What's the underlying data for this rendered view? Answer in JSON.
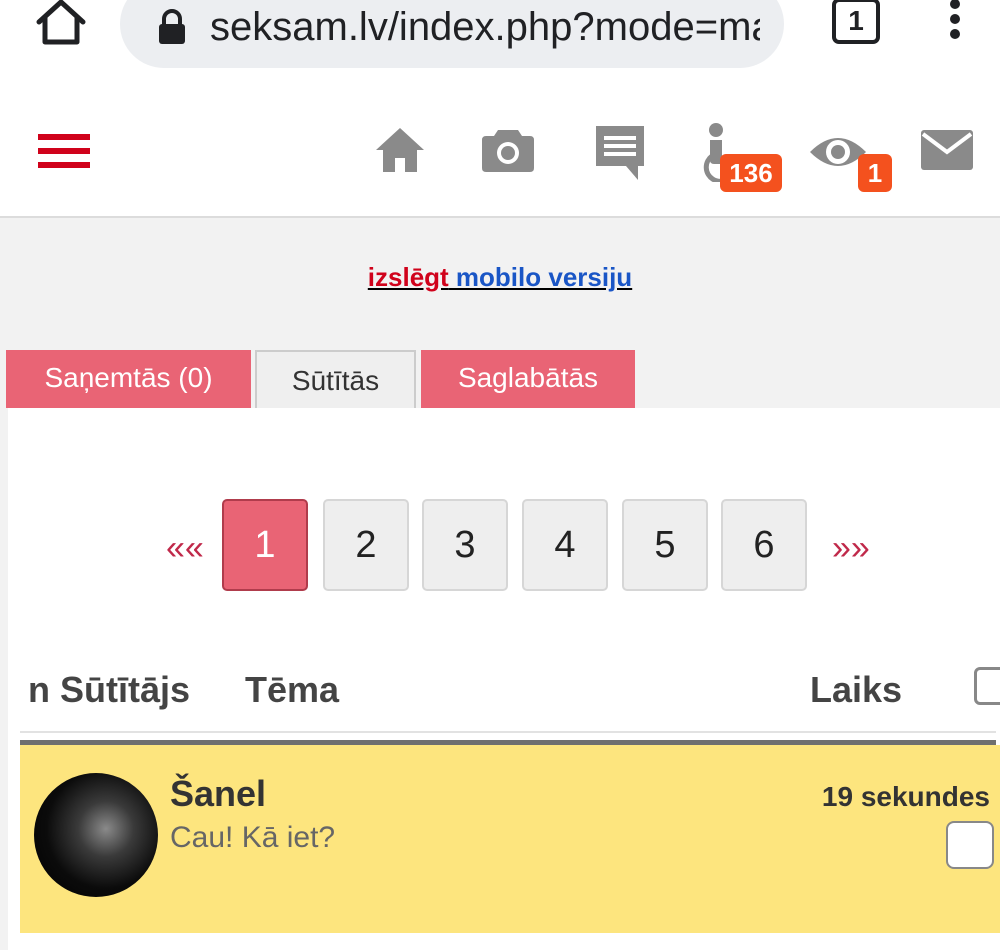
{
  "browser": {
    "url": "seksam.lv/index.php?mode=ma",
    "tab_count": "1"
  },
  "header": {
    "icons": [
      "menu-icon",
      "home-icon",
      "camera-icon",
      "chat-icon",
      "visitors-icon",
      "eye-icon",
      "mail-icon"
    ],
    "accent_color": "#d0021b",
    "badges": {
      "visitors": "136",
      "views": "1"
    }
  },
  "mobile_switch": {
    "red_part": "izslēgt",
    "blue_part": " mobilo versiju"
  },
  "folders": {
    "tabs": [
      {
        "label": "Saņemtās (0)",
        "active": false
      },
      {
        "label": "Sūtītās",
        "active": true
      },
      {
        "label": "Saglabātās",
        "active": false
      }
    ],
    "tab_color": "#e96475"
  },
  "pagination": {
    "prev": "««",
    "next": "»»",
    "pages": [
      "1",
      "2",
      "3",
      "4",
      "5",
      "6"
    ],
    "current": "1"
  },
  "table": {
    "columns": {
      "sender": "n Sūtītājs",
      "subject": "Tēma",
      "time": "Laiks"
    },
    "rows": [
      {
        "sender": "Šanel",
        "subject": "Cau! Kā iet?",
        "time": "19 sekundes",
        "row_color": "#fde57e"
      }
    ]
  }
}
